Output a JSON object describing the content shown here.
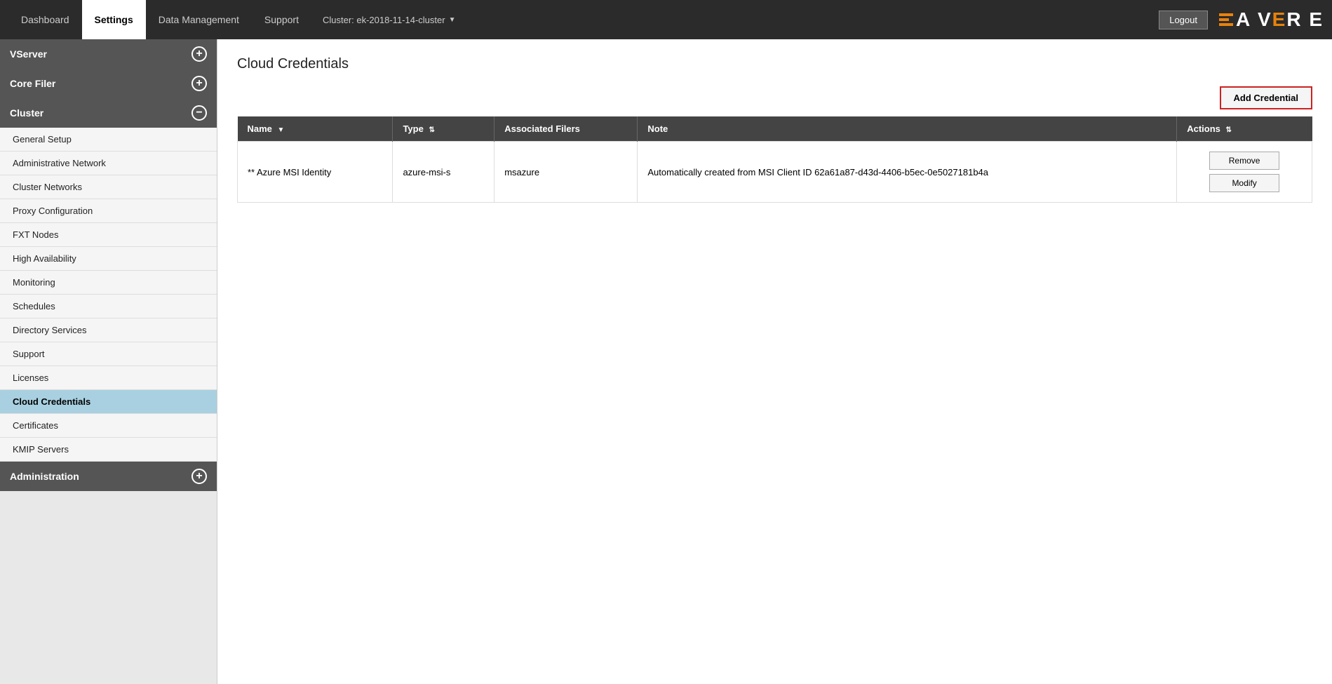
{
  "topbar": {
    "tabs": [
      {
        "label": "Dashboard",
        "active": false
      },
      {
        "label": "Settings",
        "active": true
      },
      {
        "label": "Data Management",
        "active": false
      },
      {
        "label": "Support",
        "active": false
      }
    ],
    "cluster_label": "Cluster: ek-2018-11-14-cluster",
    "logout_label": "Logout",
    "logo_text": "A V",
    "logo_e": "E",
    "logo_re": " R E"
  },
  "sidebar": {
    "sections": [
      {
        "label": "VServer",
        "icon": "+",
        "items": []
      },
      {
        "label": "Core Filer",
        "icon": "+",
        "items": []
      },
      {
        "label": "Cluster",
        "icon": "−",
        "items": [
          {
            "label": "General Setup",
            "active": false
          },
          {
            "label": "Administrative Network",
            "active": false
          },
          {
            "label": "Cluster Networks",
            "active": false
          },
          {
            "label": "Proxy Configuration",
            "active": false
          },
          {
            "label": "FXT Nodes",
            "active": false
          },
          {
            "label": "High Availability",
            "active": false
          },
          {
            "label": "Monitoring",
            "active": false
          },
          {
            "label": "Schedules",
            "active": false
          },
          {
            "label": "Directory Services",
            "active": false
          },
          {
            "label": "Support",
            "active": false
          },
          {
            "label": "Licenses",
            "active": false
          },
          {
            "label": "Cloud Credentials",
            "active": true
          },
          {
            "label": "Certificates",
            "active": false
          },
          {
            "label": "KMIP Servers",
            "active": false
          }
        ]
      },
      {
        "label": "Administration",
        "icon": "+",
        "items": []
      }
    ]
  },
  "content": {
    "page_title": "Cloud Credentials",
    "add_credential_label": "Add Credential",
    "table": {
      "columns": [
        {
          "label": "Name",
          "sortable": true
        },
        {
          "label": "Type",
          "sortable": true
        },
        {
          "label": "Associated Filers",
          "sortable": false
        },
        {
          "label": "Note",
          "sortable": false
        },
        {
          "label": "Actions",
          "sortable": true
        }
      ],
      "rows": [
        {
          "name": "** Azure MSI Identity",
          "type": "azure-msi-s",
          "associated_filers": "msazure",
          "note": "Automatically created from MSI Client ID 62a61a87-d43d-4406-b5ec-0e5027181b4a",
          "actions": [
            "Remove",
            "Modify"
          ]
        }
      ]
    }
  }
}
